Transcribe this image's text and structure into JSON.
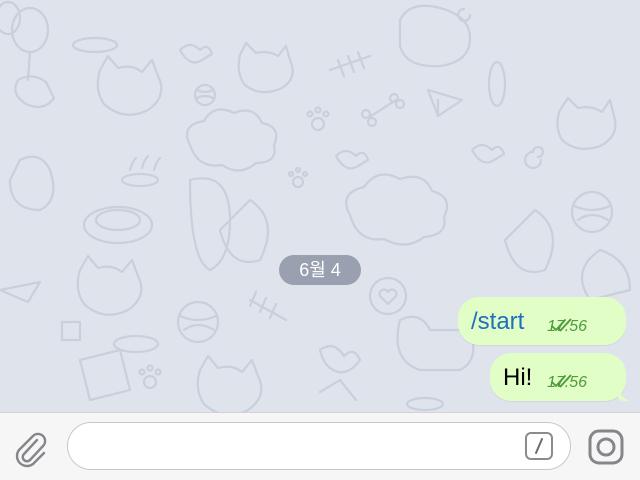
{
  "chat": {
    "date_separator": "6월 4",
    "messages": [
      {
        "text": "/start",
        "time": "17:56",
        "status": "read",
        "is_command": true
      },
      {
        "text": "Hi!",
        "time": "17:56",
        "status": "read",
        "is_command": false
      }
    ]
  },
  "input": {
    "placeholder": "",
    "value": ""
  },
  "icons": {
    "attach": "paperclip-icon",
    "commands": "slash-command-icon",
    "camera": "camera-icon"
  },
  "colors": {
    "chat_background": "#dfe3ec",
    "outgoing_bubble": "#e1fec6",
    "meta_green": "#4f9b3d",
    "command_blue": "#1f6fbf",
    "date_pill": "#6e788a"
  }
}
